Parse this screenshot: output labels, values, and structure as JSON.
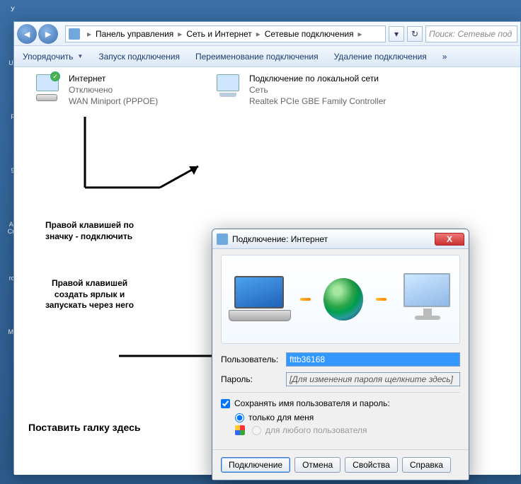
{
  "breadcrumb": {
    "p1": "Панель управления",
    "p2": "Сеть и Интернет",
    "p3": "Сетевые подключения"
  },
  "search": {
    "placeholder": "Поиск: Сетевые под"
  },
  "toolbar": {
    "organize": "Упорядочить",
    "start": "Запуск подключения",
    "rename": "Переименование подключения",
    "delete": "Удаление подключения",
    "more": "»"
  },
  "connA": {
    "name": "Интернет",
    "status": "Отключено",
    "device": "WAN Miniport (PPPOE)"
  },
  "connB": {
    "name": "Подключение по локальной сети",
    "status": "Сеть",
    "device": "Realtek PCIe GBE Family Controller"
  },
  "ann": {
    "a1l1": "Правой клавишей по",
    "a1l2": "значку - подключить",
    "a2l1": "Правой клавишей",
    "a2l2": "создать ярлык и",
    "a2l3": "запускать через него",
    "a3": "Поставить галку здесь"
  },
  "dialog": {
    "title": "Подключение: Интернет",
    "user_label": "Пользователь:",
    "user_value": "fttb36168",
    "pass_label": "Пароль:",
    "pass_hint": "[Для изменения пароля щелкните здесь]",
    "save_label": "Сохранять имя пользователя и пароль:",
    "r_me": "только для меня",
    "r_all": "для любого пользователя",
    "btn_connect": "Подключение",
    "btn_cancel": "Отмена",
    "btn_props": "Свойства",
    "btn_help": "Справка",
    "close": "X"
  }
}
